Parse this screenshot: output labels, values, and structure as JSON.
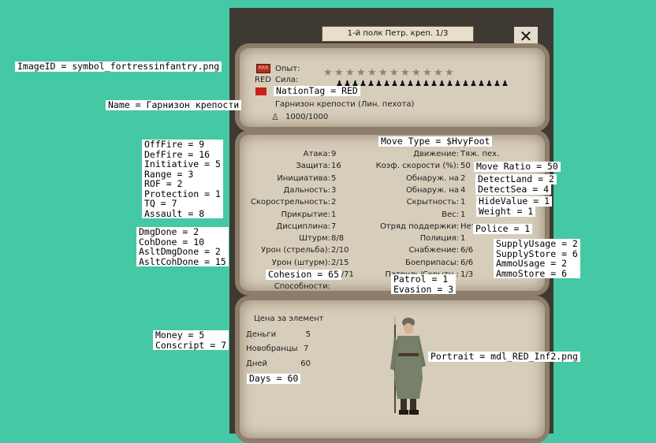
{
  "window": {
    "title": "1-й полк Петр. креп. 1/3",
    "close_label": "✕"
  },
  "unit": {
    "experience_label": "Опыт:",
    "strength_label": "Сила:",
    "nation_code": "RED",
    "name_line": "Гарнизон крепости (Лин. пехота)",
    "manpower": "1000/1000",
    "icon_text": "RRR"
  },
  "stats_left": [
    {
      "label": "Атака:",
      "value": "9"
    },
    {
      "label": "Защита:",
      "value": "16"
    },
    {
      "label": "Инициатива:",
      "value": "5"
    },
    {
      "label": "Дальность:",
      "value": "3"
    },
    {
      "label": "Скорострельность:",
      "value": "2"
    },
    {
      "label": "Прикрытие:",
      "value": "1"
    },
    {
      "label": "Дисциплина:",
      "value": "7"
    },
    {
      "label": "Штурм:",
      "value": "8/8"
    },
    {
      "label": "Урон (стрельба):",
      "value": "2/10"
    },
    {
      "label": "Урон (штурм):",
      "value": "2/15"
    },
    {
      "label": "Слаженность:",
      "value": "66/71"
    },
    {
      "label": "Способности:",
      "value": ""
    }
  ],
  "stats_right": [
    {
      "label": "Движение:",
      "value": "Тяж. пех."
    },
    {
      "label": "Коэф. скорости (%):",
      "value": "50"
    },
    {
      "label": "Обнаруж. на",
      "value": "2"
    },
    {
      "label": "Обнаруж. на",
      "value": "4"
    },
    {
      "label": "Скрытность:",
      "value": "1"
    },
    {
      "label": "Вес:",
      "value": "1"
    },
    {
      "label": "Отряд поддержки:",
      "value": "Нет"
    },
    {
      "label": "Полиция:",
      "value": "1"
    },
    {
      "label": "Снабжение:",
      "value": "6/6"
    },
    {
      "label": "Боеприпасы:",
      "value": "6/6"
    },
    {
      "label": "Патруль/Скрытн.:",
      "value": "1/3"
    }
  ],
  "cost": {
    "header": "Цена за элемент",
    "rows": [
      {
        "label": "Деньги",
        "value": "5"
      },
      {
        "label": "Новобранцы",
        "value": "7"
      },
      {
        "label": "Дней",
        "value": "60"
      }
    ]
  },
  "annotations": {
    "image_id": "ImageID = symbol_fortressinfantry.png",
    "nation_tag": "NationTag = RED",
    "name": "Name = Гарнизон крепости",
    "move_type": "Move Type = $HvyFoot",
    "move_ratio": "Move Ratio = 50",
    "detect_land": "DetectLand = 2",
    "detect_sea": "DetectSea = 4",
    "hide_value": "HideValue = 1",
    "weight": "Weight = 1",
    "police": "Police = 1",
    "combat": [
      "OffFire = 9",
      "DefFire = 16",
      "Initiative = 5",
      "Range = 3",
      "ROF = 2",
      "Protection = 1",
      "TQ = 7",
      "Assault = 8"
    ],
    "damage": [
      "DmgDone = 2",
      "CohDone = 10",
      "AsltDmgDone = 2",
      "AsltCohDone = 15"
    ],
    "supply": [
      "SupplyUsage = 2",
      "SupplyStore = 6",
      "AmmoUsage = 2",
      "AmmoStore = 6"
    ],
    "cohesion": "Cohesion = 65",
    "patrol": [
      "Patrol = 1",
      "Evasion = 3"
    ],
    "money": [
      "Money = 5",
      "Conscript = 7"
    ],
    "days": "Days = 60",
    "portrait": "Portrait = mdl_RED_Inf2.png"
  },
  "colors": {
    "background": "#45c8a4",
    "parchment": "#d7cdbb",
    "frame": "#3e3a33",
    "flag_red": "#c8201a"
  }
}
